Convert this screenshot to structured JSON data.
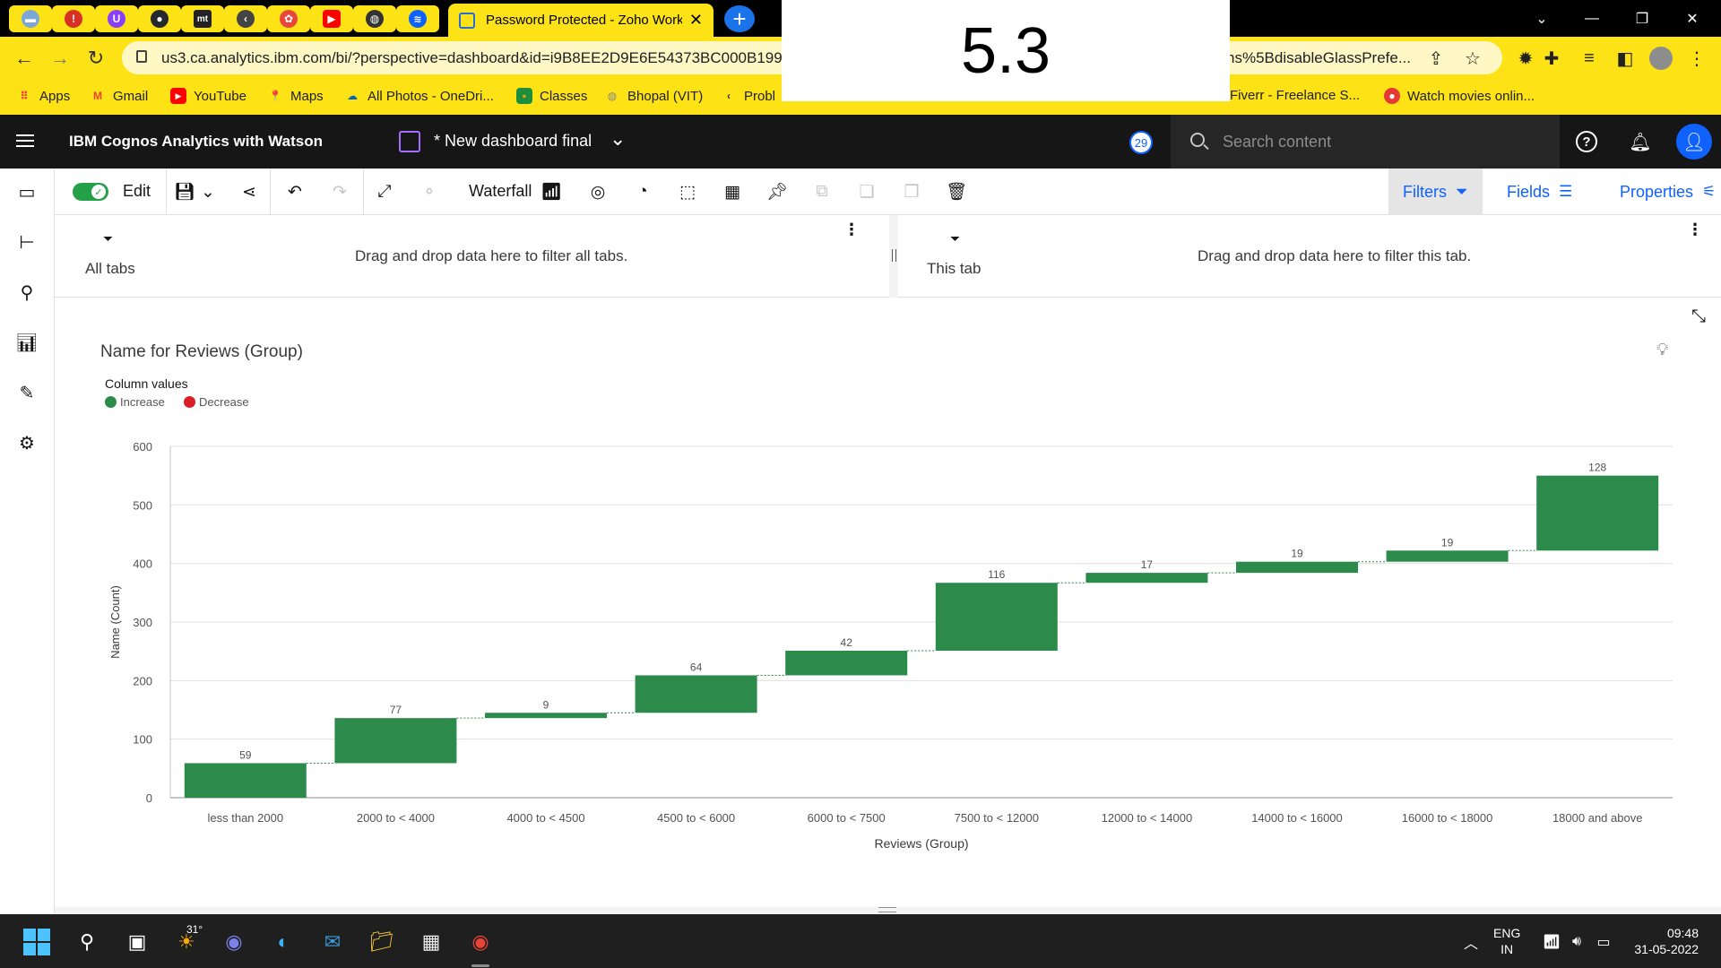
{
  "browser": {
    "tab_title": "Password Protected - Zoho Work",
    "tab_icons": [
      "mail-icon",
      "alert-icon",
      "shield-icon",
      "github-icon",
      "mt-icon",
      "arrow-icon",
      "puzzle-icon",
      "youtube-icon",
      "globe-icon",
      "cognos-icon"
    ],
    "url": "us3.ca.analytics.ibm.com/bi/?perspective=dashboard&id=i9B8EE2D9E6E54373BC000B199",
    "url_tail": "ns%5BdisableGlassPrefe...",
    "bookmarks": [
      {
        "label": "Apps",
        "icon": "apps-icon",
        "color": "#e8453c"
      },
      {
        "label": "Gmail",
        "icon": "gmail-icon",
        "color": "#ea4335"
      },
      {
        "label": "YouTube",
        "icon": "youtube-icon",
        "color": "#ff0000"
      },
      {
        "label": "Maps",
        "icon": "maps-icon",
        "color": "#34a853"
      },
      {
        "label": "All Photos - OneDri...",
        "icon": "onedrive-icon",
        "color": "#0364b8"
      },
      {
        "label": "Classes",
        "icon": "classroom-icon",
        "color": "#f9ab00"
      },
      {
        "label": "Bhopal (VIT)",
        "icon": "globe-icon",
        "color": "#888888"
      },
      {
        "label": "Probl",
        "icon": "arrow-icon",
        "color": "#333333"
      },
      {
        "label": "Fiverr - Freelance S...",
        "icon": "fiverr-icon",
        "color": "#1dbf73"
      },
      {
        "label": "Watch movies onlin...",
        "icon": "movie-icon",
        "color": "#e53935"
      }
    ]
  },
  "overlay": {
    "text": "5.3"
  },
  "header": {
    "app_name": "IBM Cognos Analytics with Watson",
    "dashboard_name": "* New dashboard final",
    "notification_count": "29",
    "search_placeholder": "Search content"
  },
  "toolbar": {
    "edit_label": "Edit",
    "visualization_label": "Waterfall",
    "filters_label": "Filters",
    "fields_label": "Fields",
    "properties_label": "Properties"
  },
  "filters": {
    "all_tabs_label": "All tabs",
    "all_tabs_hint": "Drag and drop data here to filter all tabs.",
    "this_tab_label": "This tab",
    "this_tab_hint": "Drag and drop data here to filter this tab."
  },
  "widget": {
    "title": "Name for Reviews (Group)",
    "legend_title": "Column values",
    "legend": [
      {
        "label": "Increase",
        "color": "#2c8a4a"
      },
      {
        "label": "Decrease",
        "color": "#da1e28"
      }
    ]
  },
  "chart_data": {
    "type": "bar",
    "subtype": "waterfall",
    "title": "Name for Reviews (Group)",
    "xlabel": "Reviews (Group)",
    "ylabel": "Name (Count)",
    "ylim": [
      0,
      600
    ],
    "yticks": [
      0,
      100,
      200,
      300,
      400,
      500,
      600
    ],
    "grid": true,
    "legend_position": "top-left",
    "increase_color": "#2c8a4a",
    "decrease_color": "#da1e28",
    "categories": [
      "less than 2000",
      "2000 to < 4000",
      "4000 to < 4500",
      "4500 to < 6000",
      "6000 to < 7500",
      "7500 to < 12000",
      "12000 to < 14000",
      "14000 to < 16000",
      "16000 to < 18000",
      "18000 and above"
    ],
    "values": [
      59,
      77,
      9,
      64,
      42,
      116,
      17,
      19,
      19,
      128
    ]
  },
  "taskbar": {
    "weather_temp": "31°",
    "language": "ENG",
    "region": "IN",
    "time": "09:48",
    "date": "31-05-2022"
  }
}
